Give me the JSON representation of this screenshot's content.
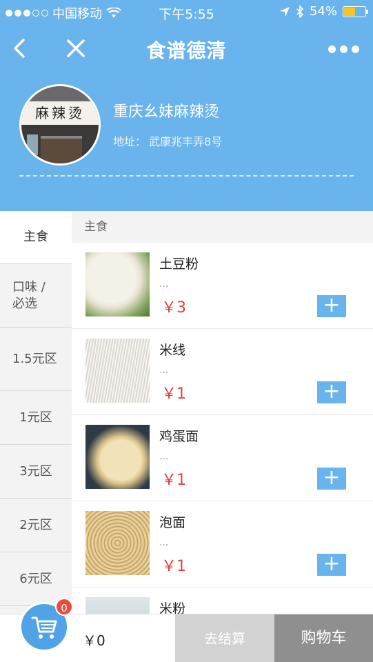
{
  "status_bar": {
    "carrier": "中国移动",
    "time": "下午5:55",
    "battery": "54%",
    "battery_level": 0.54
  },
  "nav": {
    "back_icon": "back-chevron-icon",
    "close_icon": "close-icon",
    "title": "食谱德清",
    "more_icon": "more-dots-icon"
  },
  "store": {
    "name": "重庆幺妹麻辣烫",
    "address_label": "地址：",
    "address": "武康兆丰弄8号",
    "sign_text": "麻辣烫"
  },
  "categories": [
    {
      "label": "主食",
      "active": true
    },
    {
      "label": "口味 / 必选",
      "active": false
    },
    {
      "label": "1.5元区",
      "active": false
    },
    {
      "label": "1元区",
      "active": false
    },
    {
      "label": "3元区",
      "active": false
    },
    {
      "label": "2元区",
      "active": false
    },
    {
      "label": "6元区",
      "active": false
    }
  ],
  "section_title": "主食",
  "items": [
    {
      "name": "土豆粉",
      "desc": "...",
      "price": "￥3"
    },
    {
      "name": "米线",
      "desc": "...",
      "price": "￥1"
    },
    {
      "name": "鸡蛋面",
      "desc": "...",
      "price": "￥1"
    },
    {
      "name": "泡面",
      "desc": "...",
      "price": "￥1"
    },
    {
      "name": "米粉",
      "desc": "",
      "price": ""
    }
  ],
  "add_icon": "plus-icon",
  "bottom": {
    "badge_count": "0",
    "total": "￥0",
    "checkout": "去结算",
    "cart": "购物车"
  },
  "colors": {
    "primary": "#6ab4ee",
    "price": "#e0403a",
    "badge": "#e94b3c"
  }
}
